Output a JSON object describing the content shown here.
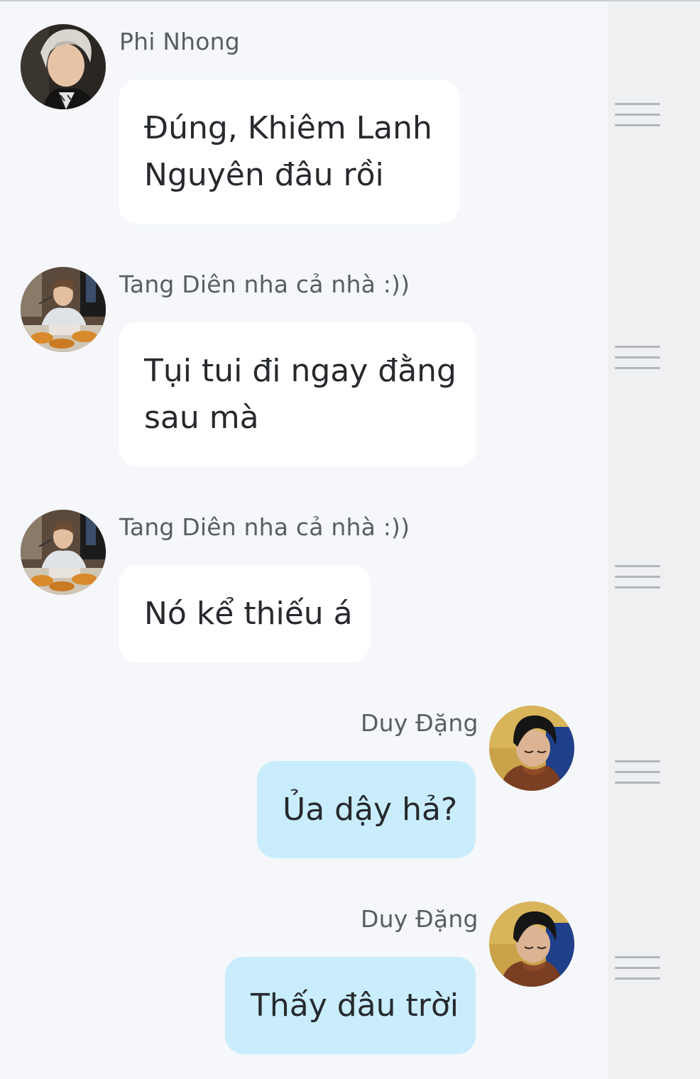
{
  "messages": [
    {
      "sender": "Phi Nhong",
      "direction": "incoming",
      "lines": [
        "Đúng, Khiêm Lanh",
        "Nguyên đâu rồi"
      ],
      "avatar": "avatar-blonde-hair"
    },
    {
      "sender": "Tang Diên nha cả nhà :))",
      "direction": "incoming",
      "lines": [
        "Tụi tui đi ngay đằng",
        "sau mà"
      ],
      "avatar": "avatar-dining"
    },
    {
      "sender": "Tang Diên nha cả nhà :))",
      "direction": "incoming",
      "lines": [
        "Nó kể thiếu á"
      ],
      "avatar": "avatar-dining"
    },
    {
      "sender": "Duy Đặng",
      "direction": "outgoing",
      "lines": [
        "Ủa dậy hả?"
      ],
      "avatar": "avatar-sleeping"
    },
    {
      "sender": "Duy Đặng",
      "direction": "outgoing",
      "lines": [
        "Thấy đâu trời"
      ],
      "avatar": "avatar-sleeping"
    }
  ],
  "colors": {
    "background": "#f5f7fa",
    "incoming_bubble": "#ffffff",
    "outgoing_bubble": "#c9edfd",
    "handle_strip": "#eff0f2",
    "text": "#26292d",
    "sender_text": "#595d62"
  },
  "icons": {
    "reorder_handle": "drag-handle-icon"
  }
}
